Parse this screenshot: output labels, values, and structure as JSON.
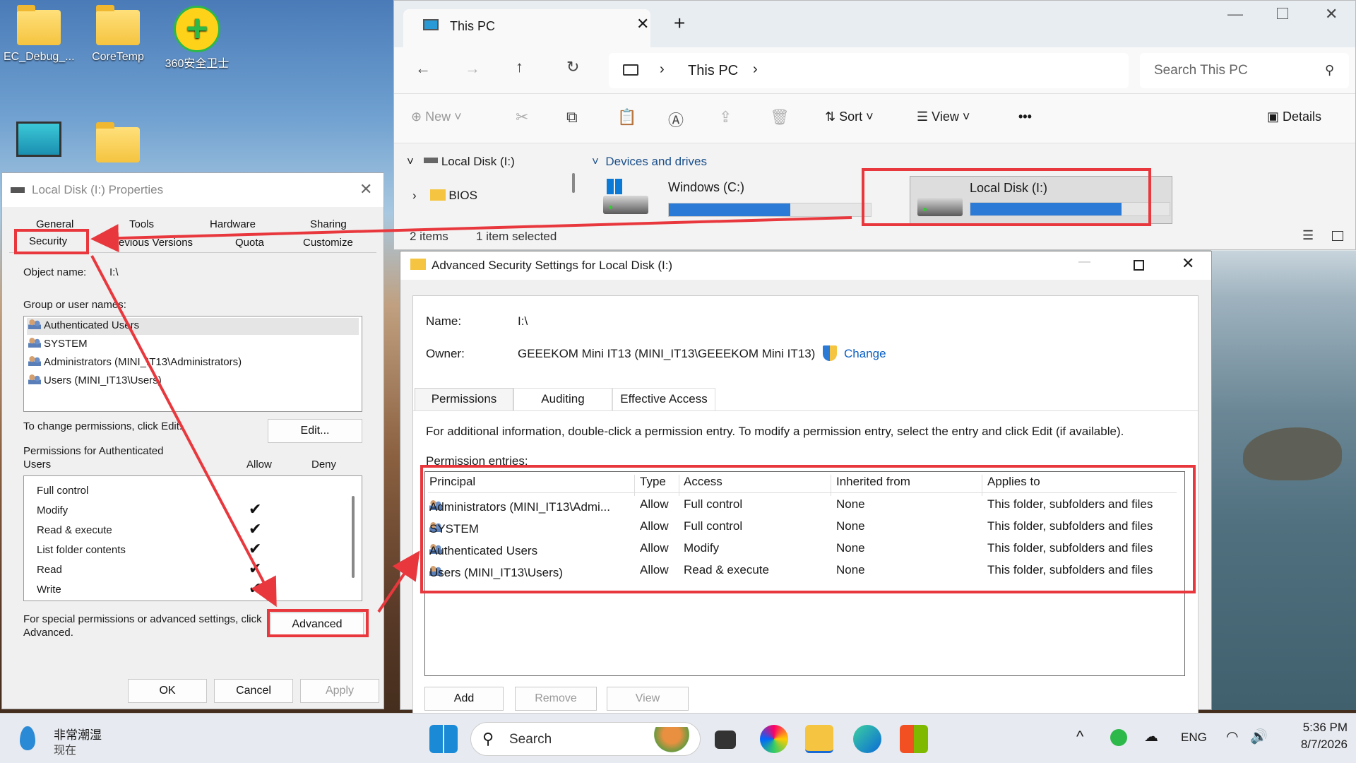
{
  "desktop": {
    "icons": [
      {
        "label": "EC_Debug_..."
      },
      {
        "label": "CoreTemp"
      },
      {
        "label": "360安全卫士"
      },
      {
        "label": ""
      },
      {
        "label": ""
      }
    ]
  },
  "explorer": {
    "tab_title": "This PC",
    "address_segment": "This PC",
    "search_placeholder": "Search This PC",
    "toolbar": {
      "new": "New",
      "sort": "Sort",
      "view": "View",
      "more": "•••",
      "details": "Details"
    },
    "tree": [
      {
        "label": "Local Disk (I:)"
      },
      {
        "label": "BIOS"
      }
    ],
    "section_header": "Devices and drives",
    "drives": [
      {
        "name": "Windows (C:)",
        "used_fraction": 0.6
      },
      {
        "name": "Local Disk (I:)",
        "used_fraction": 0.76
      }
    ],
    "status": {
      "count": "2 items",
      "selected": "1 item selected"
    }
  },
  "properties": {
    "title": "Local Disk (I:) Properties",
    "tabs_row1": [
      "General",
      "Tools",
      "Hardware",
      "Sharing"
    ],
    "tabs_row2": [
      "Security",
      "Previous Versions",
      "Quota",
      "Customize"
    ],
    "object_name_label": "Object name:",
    "object_name_value": "I:\\",
    "group_label": "Group or user names:",
    "users": [
      "Authenticated Users",
      "SYSTEM",
      "Administrators (MINI_IT13\\Administrators)",
      "Users (MINI_IT13\\Users)"
    ],
    "change_text": "To change permissions, click Edit.",
    "edit_button": "Edit...",
    "perms_for": "Permissions for Authenticated Users",
    "allow_header": "Allow",
    "deny_header": "Deny",
    "perms": [
      {
        "name": "Full control",
        "allow": false
      },
      {
        "name": "Modify",
        "allow": true
      },
      {
        "name": "Read & execute",
        "allow": true
      },
      {
        "name": "List folder contents",
        "allow": true
      },
      {
        "name": "Read",
        "allow": true
      },
      {
        "name": "Write",
        "allow": true
      }
    ],
    "special_text": "For special permissions or advanced settings, click Advanced.",
    "advanced_button": "Advanced",
    "ok": "OK",
    "cancel": "Cancel",
    "apply": "Apply"
  },
  "advanced": {
    "title": "Advanced Security Settings for Local Disk (I:)",
    "name_label": "Name:",
    "name_value": "I:\\",
    "owner_label": "Owner:",
    "owner_value": "GEEEKOM Mini IT13 (MINI_IT13\\GEEEKOM Mini IT13)",
    "change_link": "Change",
    "tabs": [
      "Permissions",
      "Auditing",
      "Effective Access"
    ],
    "info_text": "For additional information, double-click a permission entry. To modify a permission entry, select the entry and click Edit (if available).",
    "entries_label": "Permission entries:",
    "columns": [
      "Principal",
      "Type",
      "Access",
      "Inherited from",
      "Applies to"
    ],
    "rows": [
      [
        "Administrators (MINI_IT13\\Admi...",
        "Allow",
        "Full control",
        "None",
        "This folder, subfolders and files"
      ],
      [
        "SYSTEM",
        "Allow",
        "Full control",
        "None",
        "This folder, subfolders and files"
      ],
      [
        "Authenticated Users",
        "Allow",
        "Modify",
        "None",
        "This folder, subfolders and files"
      ],
      [
        "Users (MINI_IT13\\Users)",
        "Allow",
        "Read & execute",
        "None",
        "This folder, subfolders and files"
      ]
    ],
    "add": "Add",
    "remove": "Remove",
    "view": "View"
  },
  "taskbar": {
    "weather_line1": "非常潮湿",
    "weather_line2": "现在",
    "search": "Search",
    "lang": "ENG",
    "time": "5:36 PM",
    "date": "8/7/2026"
  },
  "colors": {
    "annotation_red": "#e8383d",
    "accent_blue": "#2a7ad6"
  }
}
